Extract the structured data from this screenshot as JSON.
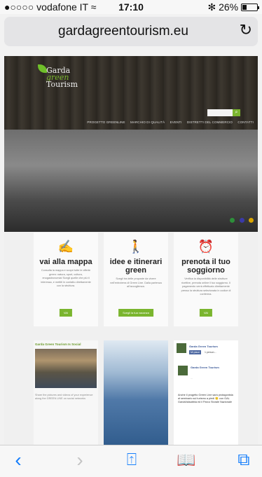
{
  "status": {
    "carrier": "●○○○○ vodafone IT",
    "wifi": "wifi-icon",
    "time": "17:10",
    "bluetooth": "✻",
    "battery": "26%"
  },
  "url_bar": {
    "url": "gardagreentourism.eu",
    "reload_icon": "reload-icon"
  },
  "site": {
    "logo": {
      "line1": "Garda",
      "line2": "green",
      "line3": "Tourism"
    },
    "search": {
      "button": "⌕"
    },
    "nav": [
      "PROGETTO GREENLINE",
      "MARCHIO DI QUALITÀ",
      "EVENTI",
      "DISTRETTI DEL COMMERCIO",
      "CONTATTI"
    ],
    "flags": [
      "#2d8f3a",
      "#3a3aa8",
      "#d9a400"
    ],
    "cards": [
      {
        "title": "vai alla mappa",
        "text": "Consulta la mappa e scopri tutte le offerte green: natura, sport, cultura, enogastronomia! Scegli quelle che più ti interessa, e mettiti in contatto direttamente con la struttura.",
        "button": "VAI",
        "icon": "✍"
      },
      {
        "title": "idee e itinerari green",
        "text": "Scegli tra delle proposte da vivere nell'entroterra di Green Line. Dalla partenza all'accoglienza.",
        "button": "Scegli la tua vacanza",
        "icon": "🚶"
      },
      {
        "title": "prenota il tuo soggiorno",
        "text": "Verifica la disponibilità delle strutture ricettive, prenota online il tuo soggiorno. Il pagamento verrà effettuato direttamente presso la struttura selezionata in codice di conferma.",
        "button": "VAI",
        "icon": "⏰"
      }
    ],
    "social": {
      "title": "Garda Green Tourism Is Social",
      "text": "Share the pictures and videos of your experience along the GREEN LINE on social networks"
    },
    "fb": {
      "page_name": "Garda Green Tourism",
      "like": "Mi piace",
      "likes_count": "1 person...",
      "post_author": "Garda Green Tourism",
      "post_date": "...",
      "post_text": "Anche il progetto Green Line sarà protagonista al seminario sul turismo a piedi 🙂 con GAL GardaValsabbia ed il Parco Storale Nazionale"
    }
  },
  "toolbar": {
    "back": "‹",
    "forward": "›",
    "share": "⍐",
    "bookmarks": "📖",
    "tabs": "⧉"
  }
}
